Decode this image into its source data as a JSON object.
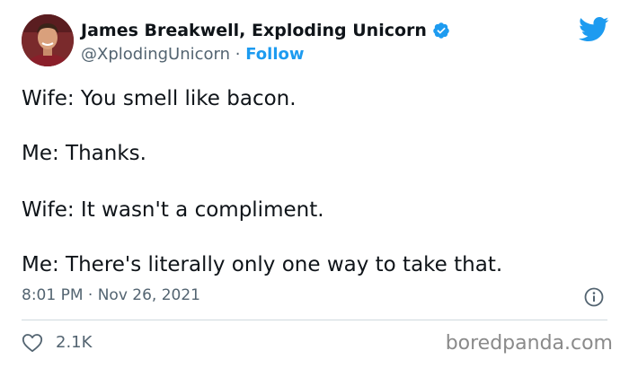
{
  "author": {
    "display_name": "James Breakwell, Exploding Unicorn",
    "handle": "@XplodingUnicorn",
    "separator": "·",
    "follow_label": "Follow",
    "verified": true
  },
  "tweet": {
    "lines": [
      "Wife: You smell like bacon.",
      "Me: Thanks.",
      "Wife: It wasn't a compliment.",
      "Me: There's literally only one way to take that."
    ],
    "timestamp": "8:01 PM · Nov 26, 2021"
  },
  "actions": {
    "like_count": "2.1K"
  },
  "watermark": "boredpanda.com",
  "icons": {
    "bird": "twitter-bird-icon",
    "verified": "verified-badge-icon",
    "info": "info-icon",
    "heart": "heart-icon"
  },
  "colors": {
    "brand_blue": "#1d9bf0",
    "text_primary": "#0f1419",
    "text_secondary": "#536471",
    "divider": "#cfd9de",
    "watermark": "#8a8a8a"
  }
}
